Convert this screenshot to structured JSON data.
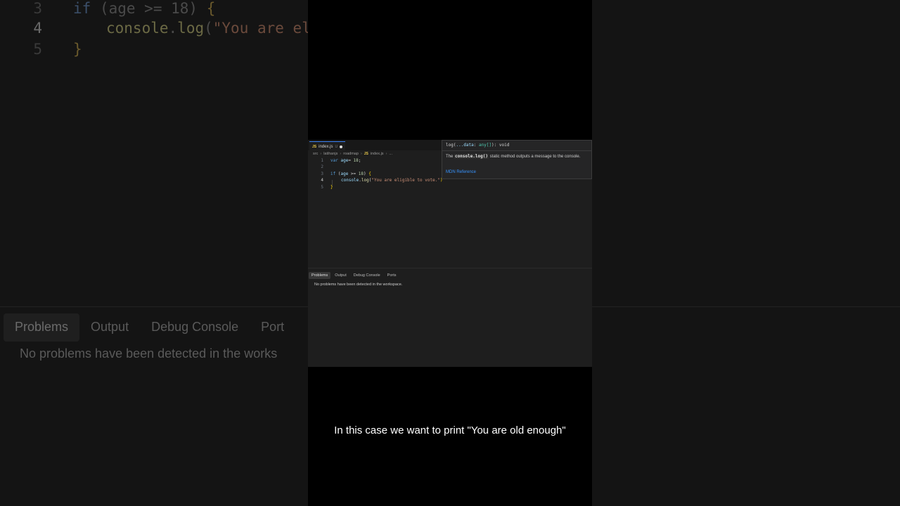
{
  "editor": {
    "tab_label": "index.js",
    "tab_badge": "JS",
    "tab_status": "U",
    "breadcrumb": [
      "src",
      "latihanjs",
      "roadmap",
      "JS",
      "index.js",
      "..."
    ],
    "lines": [
      {
        "num": "1",
        "t1": "var",
        "t2": "age",
        "t3": "= ",
        "t4": "18",
        "t5": ";"
      },
      {
        "num": "2"
      },
      {
        "num": "3",
        "t1": "if",
        "t2": " (",
        "t3": "age",
        "t4": " >= ",
        "t5": "18",
        "t6": ") ",
        "t7": "{"
      },
      {
        "num": "4",
        "t1": "console",
        "t2": ".",
        "t3": "log",
        "t4": "(",
        "t5": "\"You are eligible to vote.\"",
        "t6": ")"
      },
      {
        "num": "5",
        "t1": "}"
      }
    ]
  },
  "hover": {
    "sig_fn": "log(",
    "sig_param": "...data",
    "sig_colon": ": ",
    "sig_type": "any[]",
    "sig_rest": "): void",
    "desc_pre": "The",
    "desc_code": "console.log()",
    "desc_post": "static method outputs a message to the console.",
    "link": "MDN Reference"
  },
  "panel": {
    "tabs": [
      "Problems",
      "Output",
      "Debug Console",
      "Ports"
    ],
    "message": "No problems have been detected in the workspace."
  },
  "background": {
    "line3_num": "3",
    "line3": [
      "if",
      " (",
      "age",
      " >= ",
      "18",
      ") ",
      "{"
    ],
    "line4_num": "4",
    "line4": [
      "console",
      ".",
      "log",
      "(",
      "\"You are eli"
    ],
    "line5_num": "5",
    "line5": "}",
    "tabs": [
      "Problems",
      "Output",
      "Debug Console",
      "Port"
    ],
    "message": "No problems have been detected in the works"
  },
  "caption": "In this case we want to print \"You are old enough\""
}
